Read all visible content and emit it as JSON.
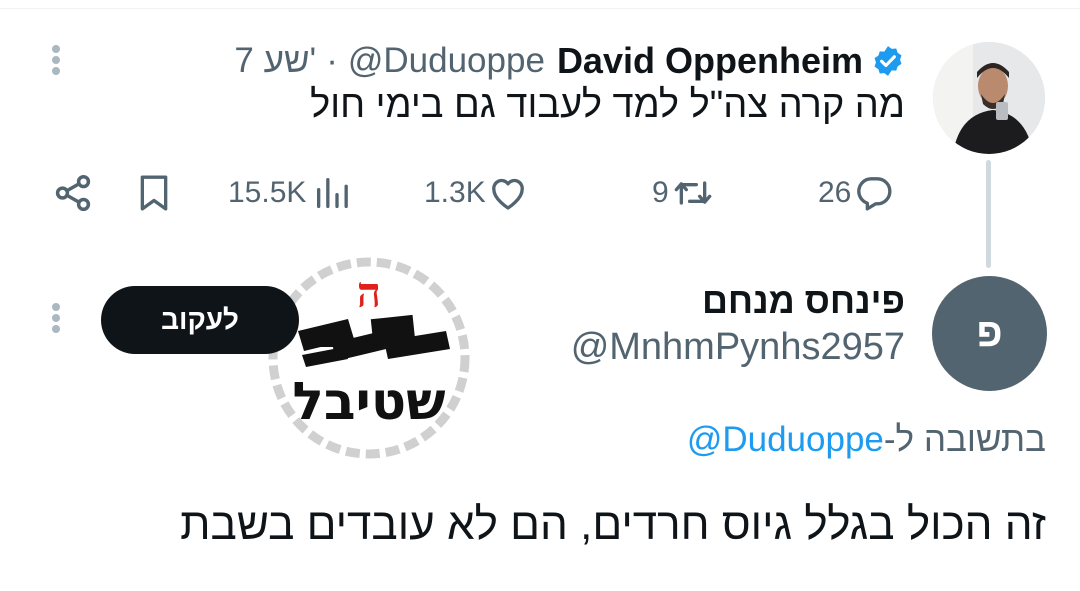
{
  "tweet1": {
    "display_name": "David Oppenheim",
    "handle": "@Duduoppe",
    "separator": "·",
    "time": "7 שע'",
    "text": "מה קרה צה\"ל למד לעבוד גם בימי חול",
    "views": "15.5K",
    "likes": "1.3K",
    "retweets": "9",
    "replies": "26"
  },
  "tweet2": {
    "display_name": "פינחס מנחם",
    "handle": "@MnhmPynhs2957",
    "avatar_initials": "פ",
    "follow_label": "לעקוב",
    "reply_prefix": "בתשובה ל-",
    "reply_handle": "@Duduoppe",
    "text": "זה הכול בגלל גיוס חרדים, הם לא עובדים בשבת",
    "logo_letter": "ה",
    "logo_word": "שטיבל"
  },
  "icons": [
    "share-icon",
    "bookmark-icon",
    "views-icon",
    "like-icon",
    "retweet-icon",
    "reply-icon",
    "verified-icon",
    "more-icon"
  ],
  "colors": {
    "accent": "#1d9bf0",
    "text": "#0f1419",
    "muted": "#536471",
    "button": "#0f1419"
  }
}
